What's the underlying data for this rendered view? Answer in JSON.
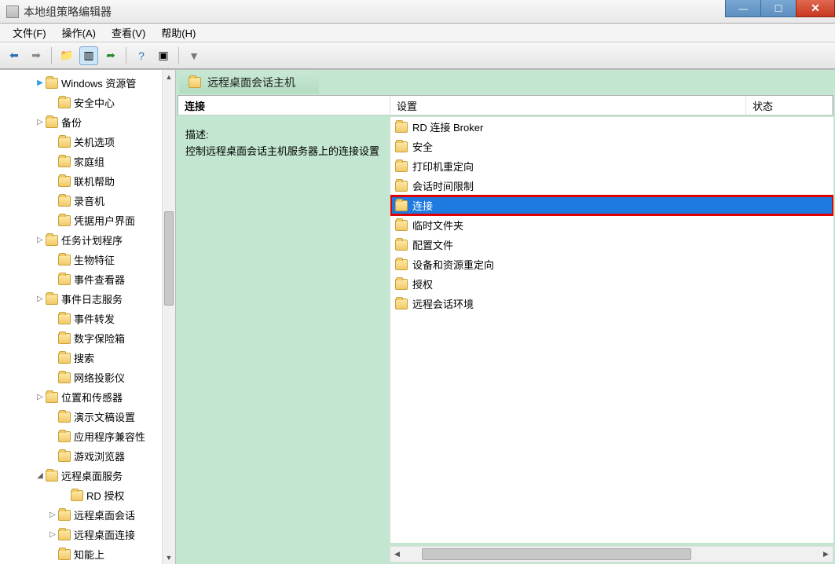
{
  "window": {
    "title": "本地组策略编辑器"
  },
  "menu": {
    "file": "文件(F)",
    "action": "操作(A)",
    "view": "查看(V)",
    "help": "帮助(H)"
  },
  "tree": {
    "items": [
      {
        "label": "Windows 资源管",
        "indent": 44,
        "chev": "▶",
        "chevColor": "#2aa0df"
      },
      {
        "label": "安全中心",
        "indent": 60
      },
      {
        "label": "备份",
        "indent": 44,
        "chev": "▷"
      },
      {
        "label": "关机选项",
        "indent": 60
      },
      {
        "label": "家庭组",
        "indent": 60
      },
      {
        "label": "联机帮助",
        "indent": 60
      },
      {
        "label": "录音机",
        "indent": 60
      },
      {
        "label": "凭据用户界面",
        "indent": 60
      },
      {
        "label": "任务计划程序",
        "indent": 44,
        "chev": "▷"
      },
      {
        "label": "生物特征",
        "indent": 60
      },
      {
        "label": "事件查看器",
        "indent": 60
      },
      {
        "label": "事件日志服务",
        "indent": 44,
        "chev": "▷"
      },
      {
        "label": "事件转发",
        "indent": 60
      },
      {
        "label": "数字保险箱",
        "indent": 60
      },
      {
        "label": "搜索",
        "indent": 60
      },
      {
        "label": "网络投影仪",
        "indent": 60
      },
      {
        "label": "位置和传感器",
        "indent": 44,
        "chev": "▷"
      },
      {
        "label": "演示文稿设置",
        "indent": 60
      },
      {
        "label": "应用程序兼容性",
        "indent": 60
      },
      {
        "label": "游戏浏览器",
        "indent": 60
      },
      {
        "label": "远程桌面服务",
        "indent": 44,
        "chev": "◢"
      },
      {
        "label": "RD 授权",
        "indent": 76
      },
      {
        "label": "远程桌面会话",
        "indent": 60,
        "chev": "▷"
      },
      {
        "label": "远程桌面连接",
        "indent": 60,
        "chev": "▷"
      },
      {
        "label": "知能上",
        "indent": 60
      }
    ]
  },
  "right": {
    "tabTitle": "远程桌面会话主机",
    "columns": {
      "a": "连接",
      "b": "设置",
      "c": "状态"
    },
    "desc": {
      "heading": "描述:",
      "body": "控制远程桌面会话主机服务器上的连接设置"
    },
    "items": [
      {
        "label": "RD 连接 Broker"
      },
      {
        "label": "安全"
      },
      {
        "label": "打印机重定向"
      },
      {
        "label": "会话时间限制"
      },
      {
        "label": "连接",
        "selected": true,
        "highlight": true
      },
      {
        "label": "临时文件夹"
      },
      {
        "label": "配置文件"
      },
      {
        "label": "设备和资源重定向"
      },
      {
        "label": "授权"
      },
      {
        "label": "远程会话环境"
      }
    ]
  }
}
